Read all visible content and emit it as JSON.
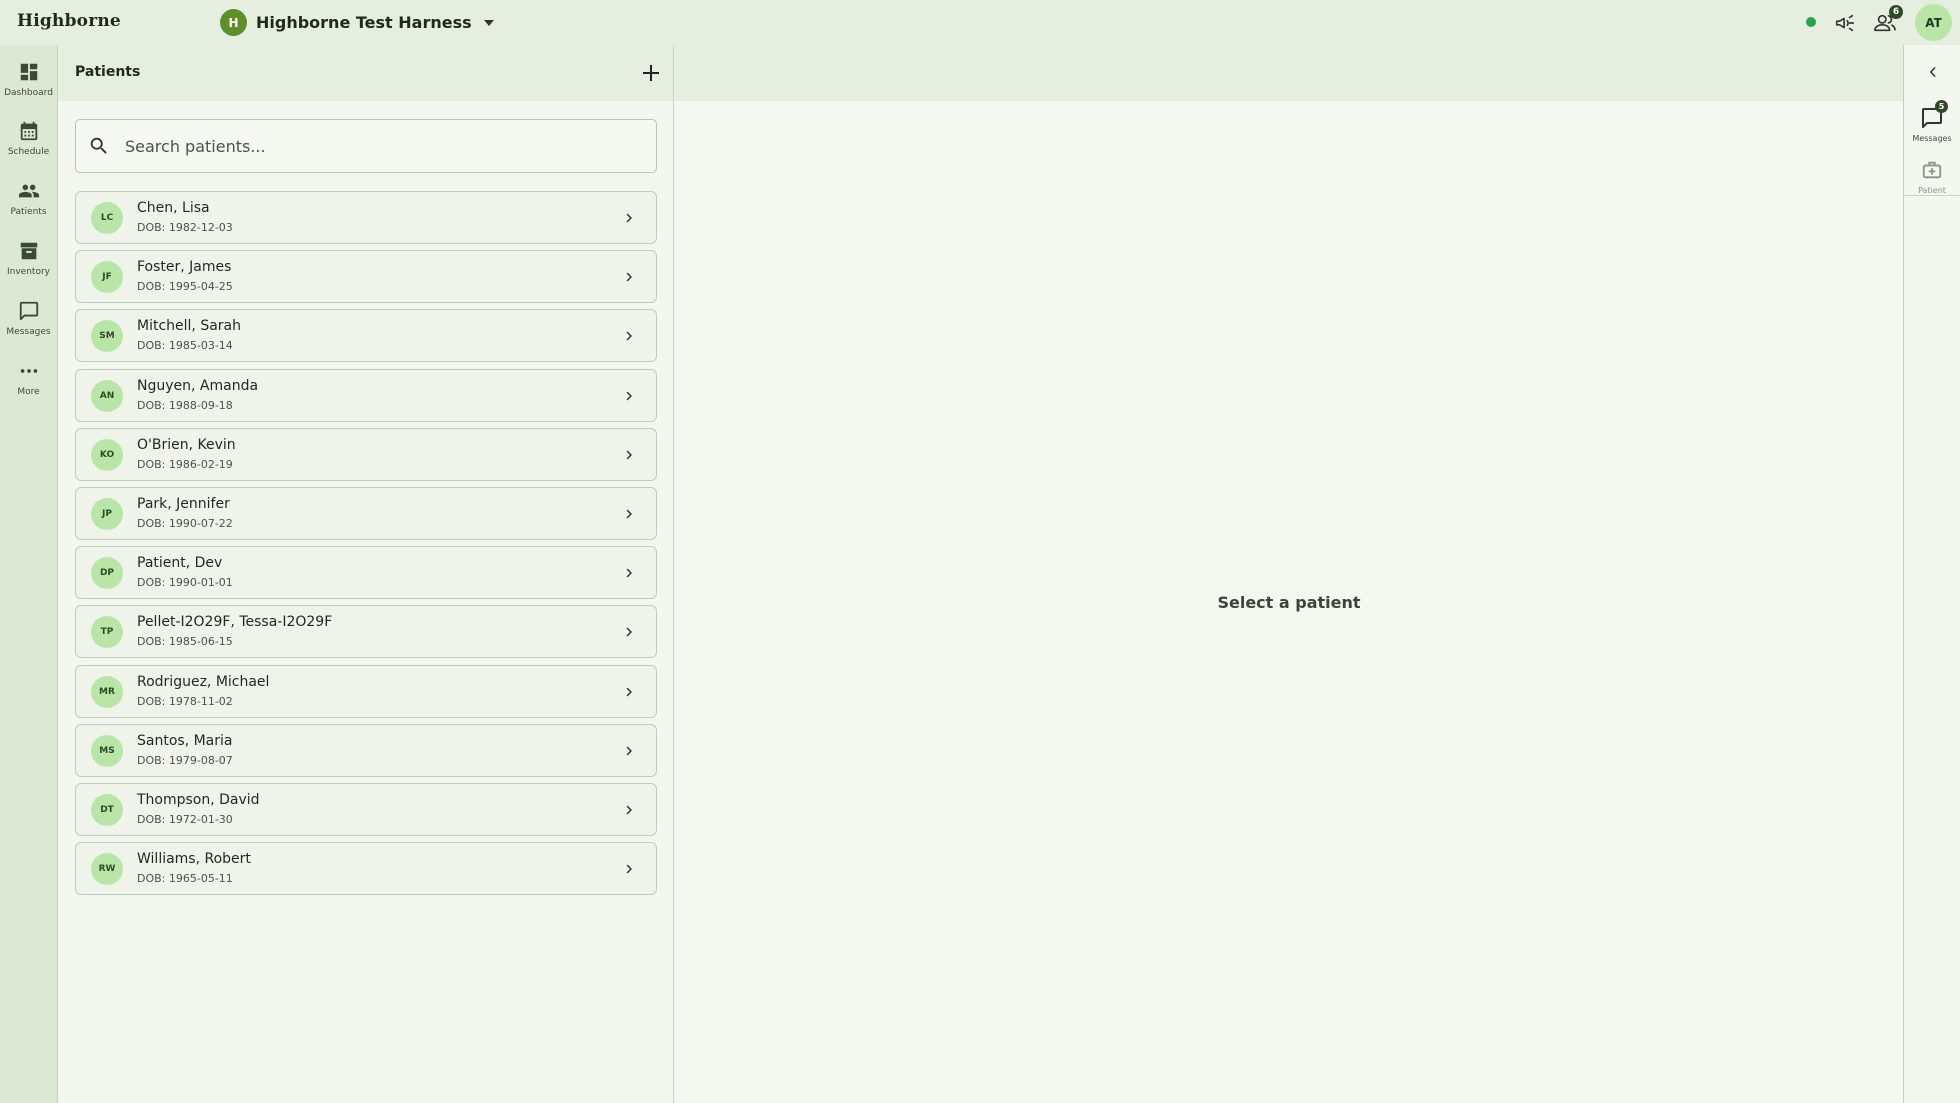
{
  "app": {
    "brand": "Highborne",
    "org": {
      "initial": "H",
      "name": "Highborne Test Harness"
    },
    "status_color": "#27a34a",
    "team_count": "6",
    "user_initials": "AT"
  },
  "nav": {
    "items": [
      {
        "label": "Dashboard",
        "icon": "dashboard-icon"
      },
      {
        "label": "Schedule",
        "icon": "calendar-icon"
      },
      {
        "label": "Patients",
        "icon": "people-icon"
      },
      {
        "label": "Inventory",
        "icon": "archive-icon"
      },
      {
        "label": "Messages",
        "icon": "chat-icon"
      },
      {
        "label": "More",
        "icon": "more-icon"
      }
    ]
  },
  "patients": {
    "title": "Patients",
    "search_placeholder": "Search patients...",
    "list": [
      {
        "initials": "LC",
        "name": "Chen, Lisa",
        "dob": "DOB: 1982-12-03"
      },
      {
        "initials": "JF",
        "name": "Foster, James",
        "dob": "DOB: 1995-04-25"
      },
      {
        "initials": "SM",
        "name": "Mitchell, Sarah",
        "dob": "DOB: 1985-03-14"
      },
      {
        "initials": "AN",
        "name": "Nguyen, Amanda",
        "dob": "DOB: 1988-09-18"
      },
      {
        "initials": "KO",
        "name": "O'Brien, Kevin",
        "dob": "DOB: 1986-02-19"
      },
      {
        "initials": "JP",
        "name": "Park, Jennifer",
        "dob": "DOB: 1990-07-22"
      },
      {
        "initials": "DP",
        "name": "Patient, Dev",
        "dob": "DOB: 1990-01-01"
      },
      {
        "initials": "TP",
        "name": "Pellet-I2O29F, Tessa-I2O29F",
        "dob": "DOB: 1985-06-15"
      },
      {
        "initials": "MR",
        "name": "Rodriguez, Michael",
        "dob": "DOB: 1978-11-02"
      },
      {
        "initials": "MS",
        "name": "Santos, Maria",
        "dob": "DOB: 1979-08-07"
      },
      {
        "initials": "DT",
        "name": "Thompson, David",
        "dob": "DOB: 1972-01-30"
      },
      {
        "initials": "RW",
        "name": "Williams, Robert",
        "dob": "DOB: 1965-05-11"
      }
    ]
  },
  "main": {
    "empty_message": "Select a patient"
  },
  "right_rail": {
    "messages": {
      "label": "Messages",
      "count": "5"
    },
    "patient": {
      "label": "Patient"
    }
  }
}
